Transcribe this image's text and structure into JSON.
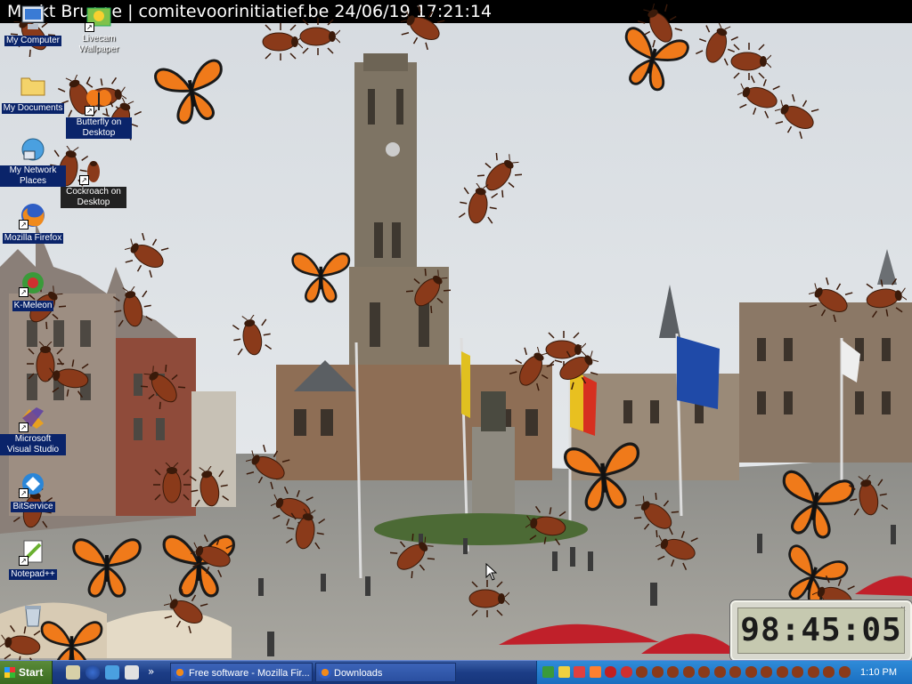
{
  "title_strip": {
    "text": "Markt Brugge | comitevoorinitiatief.be 24/06/19 17:21:14"
  },
  "desktop_icons": [
    {
      "label": "My Computer"
    },
    {
      "label": "Livecam Wallpaper"
    },
    {
      "label": "My Documents"
    },
    {
      "label": "Butterfly on Desktop"
    },
    {
      "label": "My Network Places"
    },
    {
      "label": "Cockroach on Desktop"
    },
    {
      "label": "Mozilla Firefox"
    },
    {
      "label": "K-Meleon"
    },
    {
      "label": "Microsoft Visual Studio"
    },
    {
      "label": "BitService"
    },
    {
      "label": "Notepad++"
    }
  ],
  "clock": {
    "time": "98:45:05",
    "close": "x"
  },
  "taskbar": {
    "start_label": "Start",
    "tasks": [
      {
        "label": "Free software - Mozilla Fir..."
      },
      {
        "label": "Downloads"
      }
    ],
    "time": "1:10 PM",
    "chevron": "»"
  },
  "colors": {
    "taskbar": "#1c3d86",
    "tray": "#1a6ec0",
    "start": "#3a6b20",
    "butterfly": "#f07a1a",
    "cockroach": "#8a3a1a"
  }
}
